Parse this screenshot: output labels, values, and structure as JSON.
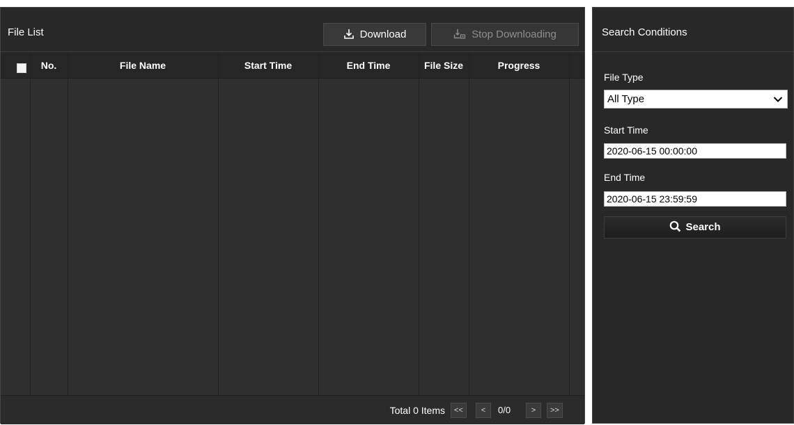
{
  "file_list": {
    "title": "File List",
    "download_label": "Download",
    "stop_label": "Stop Downloading",
    "columns": [
      "No.",
      "File Name",
      "Start Time",
      "End Time",
      "File Size",
      "Progress"
    ],
    "rows": [],
    "pager": {
      "total": "Total 0 Items",
      "first": "<<",
      "prev": "<",
      "page_info": "0/0",
      "next": ">",
      "last": ">>"
    }
  },
  "search_conditions": {
    "title": "Search Conditions",
    "file_type_label": "File Type",
    "file_type_value": "All Type",
    "start_time_label": "Start Time",
    "start_time_value": "2020-06-15 00:00:00",
    "end_time_label": "End Time",
    "end_time_value": "2020-06-15 23:59:59",
    "search_label": "Search"
  },
  "icons": {
    "download": "download-icon",
    "stop": "stop-download-icon",
    "search": "search-icon",
    "dropdown": "chevron-down-icon"
  }
}
